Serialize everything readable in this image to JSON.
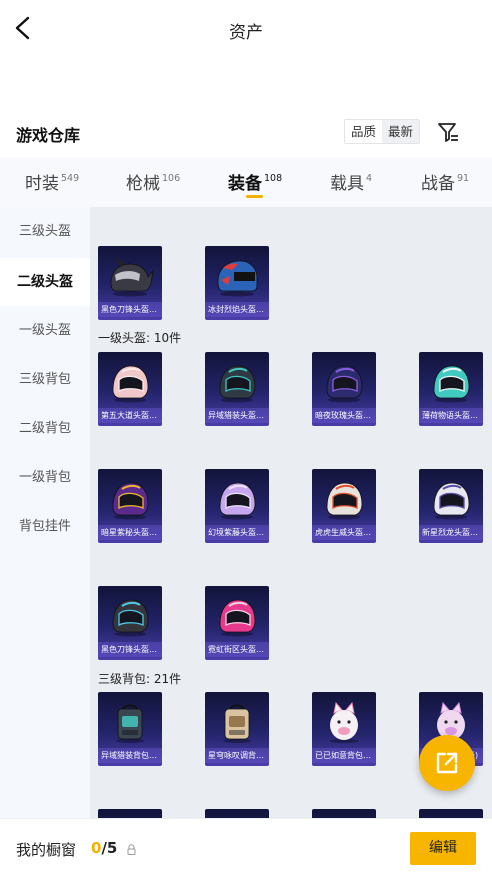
{
  "header": {
    "title": "资产",
    "back_icon": "chevron-left-icon"
  },
  "warehouse": {
    "title": "游戏仓库",
    "sort_options": [
      {
        "label": "品质",
        "selected": false
      },
      {
        "label": "最新",
        "selected": true
      }
    ],
    "filter_icon": "filter-icon"
  },
  "tabs": [
    {
      "label": "时装",
      "count": "549",
      "active": false
    },
    {
      "label": "枪械",
      "count": "106",
      "active": false
    },
    {
      "label": "装备",
      "count": "108",
      "active": true
    },
    {
      "label": "载具",
      "count": "4",
      "active": false
    },
    {
      "label": "战备",
      "count": "91",
      "active": false
    }
  ],
  "accent_color": "#f7b500",
  "sidebar": {
    "items": [
      {
        "label": "三级头盔",
        "active": false
      },
      {
        "label": "二级头盔",
        "active": true
      },
      {
        "label": "一级头盔",
        "active": false
      },
      {
        "label": "三级背包",
        "active": false
      },
      {
        "label": "二级背包",
        "active": false
      },
      {
        "label": "一级背包",
        "active": false
      },
      {
        "label": "背包挂件",
        "active": false
      }
    ]
  },
  "content": {
    "sections": [
      {
        "label": "一级头盔: 10件"
      },
      {
        "label": "三级背包: 21件"
      }
    ],
    "items": [
      {
        "name": "黑色刀锋头盔(二级)",
        "kind": "helmet-horned",
        "color": "#3a3a44",
        "accent": "#d9d9e0"
      },
      {
        "name": "冰封烈焰头盔(二级)",
        "kind": "helmet-moto",
        "color": "#2a63b8",
        "accent": "#e23b3b"
      },
      {
        "name": "第五大道头盔(一级)",
        "kind": "helmet-round",
        "color": "#f0c8c8",
        "accent": "#fbe9e9"
      },
      {
        "name": "异域猎装头盔(一级)",
        "kind": "helmet-round",
        "color": "#2f3a44",
        "accent": "#3fc7c0"
      },
      {
        "name": "暗夜玫瑰头盔(一级)",
        "kind": "helmet-round",
        "color": "#2b2b6e",
        "accent": "#8a5ce0"
      },
      {
        "name": "薄荷物语头盔(一级)",
        "kind": "helmet-round",
        "color": "#42c9c2",
        "accent": "#eafaf9"
      },
      {
        "name": "暗星紫秘头盔(一级)",
        "kind": "helmet-round",
        "color": "#5a2a8c",
        "accent": "#f0b430"
      },
      {
        "name": "幻境紫藤头盔(一级)",
        "kind": "helmet-round",
        "color": "#c6a6ee",
        "accent": "#efe4fb"
      },
      {
        "name": "虎虎生威头盔(一级)",
        "kind": "helmet-round",
        "color": "#e8e2dc",
        "accent": "#e0502e"
      },
      {
        "name": "新星烈龙头盔(一级)",
        "kind": "helmet-round",
        "color": "#e8e8f2",
        "accent": "#5a4aa8"
      },
      {
        "name": "黑色刀锋头盔(一级)",
        "kind": "helmet-round",
        "color": "#35353c",
        "accent": "#4fc8e8"
      },
      {
        "name": "霓虹街区头盔(一级)",
        "kind": "helmet-round",
        "color": "#e83a8c",
        "accent": "#ffd0e6"
      },
      {
        "name": "异域猎装背包(三级)",
        "kind": "backpack",
        "color": "#3b4750",
        "accent": "#45c7c0"
      },
      {
        "name": "星穹咏叹调背包(三级)",
        "kind": "backpack",
        "color": "#d9c4a2",
        "accent": "#8a6a40"
      },
      {
        "name": "已已如意背包(三级)",
        "kind": "backpack-plush",
        "color": "#f4f0f4",
        "accent": "#f08ab0"
      },
      {
        "name": "粉色背包(三级)",
        "kind": "backpack-plush",
        "color": "#f0d8f0",
        "accent": "#d38ae0"
      },
      {
        "name": "",
        "kind": "empty",
        "color": "#2a2a60",
        "accent": "#2a2a60"
      },
      {
        "name": "",
        "kind": "empty",
        "color": "#2a2a60",
        "accent": "#2a2a60"
      },
      {
        "name": "",
        "kind": "empty",
        "color": "#2a2a60",
        "accent": "#2a2a60"
      },
      {
        "name": "",
        "kind": "empty",
        "color": "#2a2a60",
        "accent": "#2a2a60"
      }
    ]
  },
  "fab": {
    "icon": "share-external-icon"
  },
  "showcase": {
    "label": "我的橱窗",
    "current": "0",
    "total": "/5",
    "lock_icon": "lock-icon",
    "edit_label": "编辑"
  }
}
